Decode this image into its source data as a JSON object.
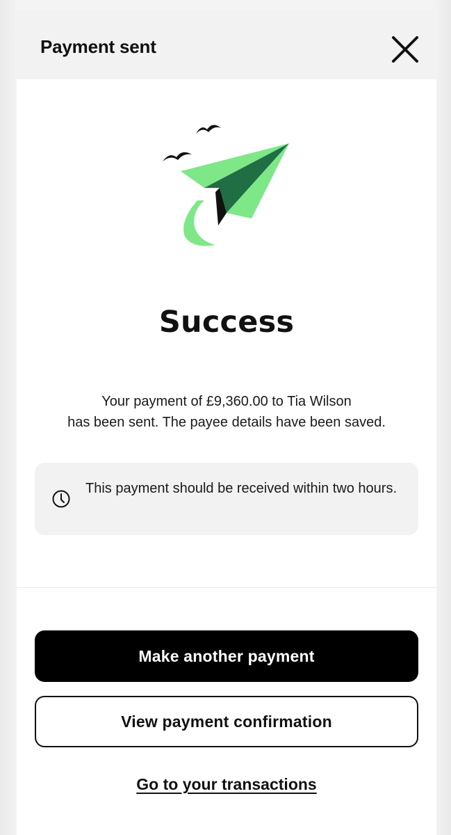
{
  "header": {
    "title": "Payment sent",
    "close_icon": "close-icon"
  },
  "illustration": {
    "icon": "paper-plane-with-birds-illustration",
    "colors": {
      "plane_light": "#7ee787",
      "plane_dark": "#1f6e44",
      "shadow": "#111111"
    }
  },
  "main": {
    "title": "Success",
    "message_line1": "Your payment of £9,360.00 to Tia Wilson",
    "message_line2": "has been sent. The payee details have been saved."
  },
  "notice": {
    "icon": "clock-icon",
    "text": "This payment should be received within two hours."
  },
  "actions": {
    "primary_label": "Make another payment",
    "secondary_label": "View payment confirmation",
    "link_label": "Go to your transactions"
  },
  "theme": {
    "primary_button": "#000000",
    "notice_background": "#f2f2f2",
    "header_background": "#f2f2f2"
  }
}
